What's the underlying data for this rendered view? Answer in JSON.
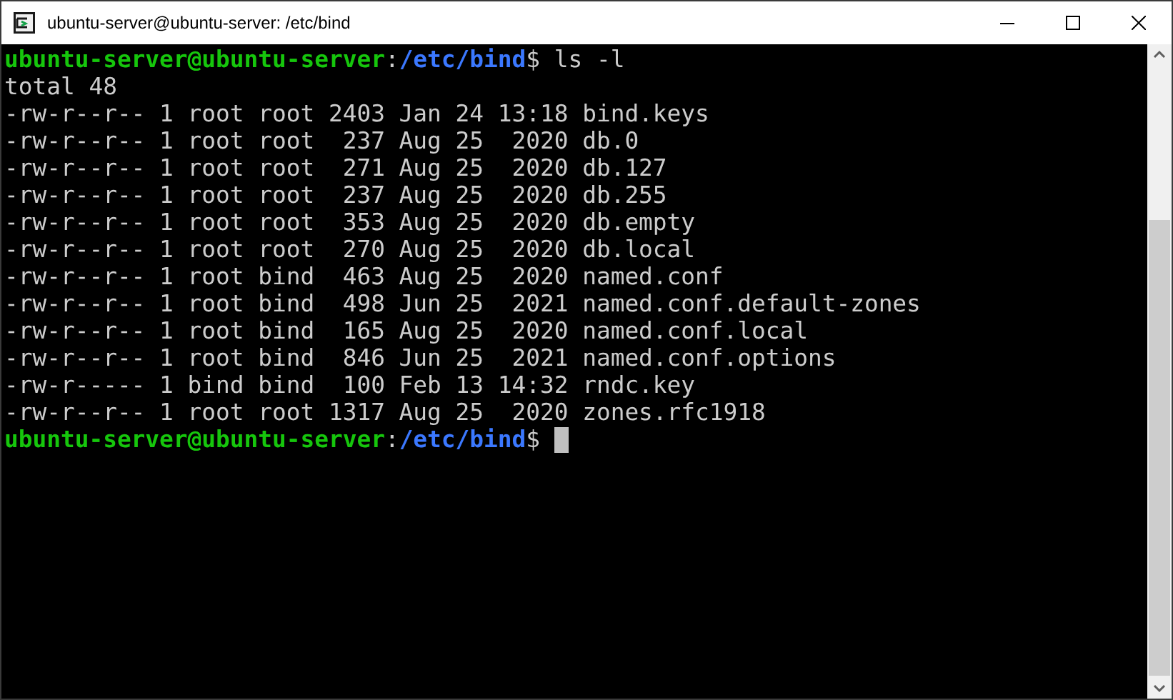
{
  "window": {
    "title": "ubuntu-server@ubuntu-server: /etc/bind"
  },
  "terminal": {
    "lines": [
      {
        "kind": "prompt",
        "user": "ubuntu-server@ubuntu-server",
        "separator": ":",
        "path": "/etc/bind",
        "symbol": "$",
        "command": "ls -l",
        "cursor": false
      },
      {
        "kind": "output",
        "text": "total 48"
      },
      {
        "kind": "output",
        "text": "-rw-r--r-- 1 root root 2403 Jan 24 13:18 bind.keys"
      },
      {
        "kind": "output",
        "text": "-rw-r--r-- 1 root root  237 Aug 25  2020 db.0"
      },
      {
        "kind": "output",
        "text": "-rw-r--r-- 1 root root  271 Aug 25  2020 db.127"
      },
      {
        "kind": "output",
        "text": "-rw-r--r-- 1 root root  237 Aug 25  2020 db.255"
      },
      {
        "kind": "output",
        "text": "-rw-r--r-- 1 root root  353 Aug 25  2020 db.empty"
      },
      {
        "kind": "output",
        "text": "-rw-r--r-- 1 root root  270 Aug 25  2020 db.local"
      },
      {
        "kind": "output",
        "text": "-rw-r--r-- 1 root bind  463 Aug 25  2020 named.conf"
      },
      {
        "kind": "output",
        "text": "-rw-r--r-- 1 root bind  498 Jun 25  2021 named.conf.default-zones"
      },
      {
        "kind": "output",
        "text": "-rw-r--r-- 1 root bind  165 Aug 25  2020 named.conf.local"
      },
      {
        "kind": "output",
        "text": "-rw-r--r-- 1 root bind  846 Jun 25  2021 named.conf.options"
      },
      {
        "kind": "output",
        "text": "-rw-r----- 1 bind bind  100 Feb 13 14:32 rndc.key"
      },
      {
        "kind": "output",
        "text": "-rw-r--r-- 1 root root 1317 Aug 25  2020 zones.rfc1918"
      },
      {
        "kind": "prompt",
        "user": "ubuntu-server@ubuntu-server",
        "separator": ":",
        "path": "/etc/bind",
        "symbol": "$",
        "cursor": true
      }
    ]
  }
}
